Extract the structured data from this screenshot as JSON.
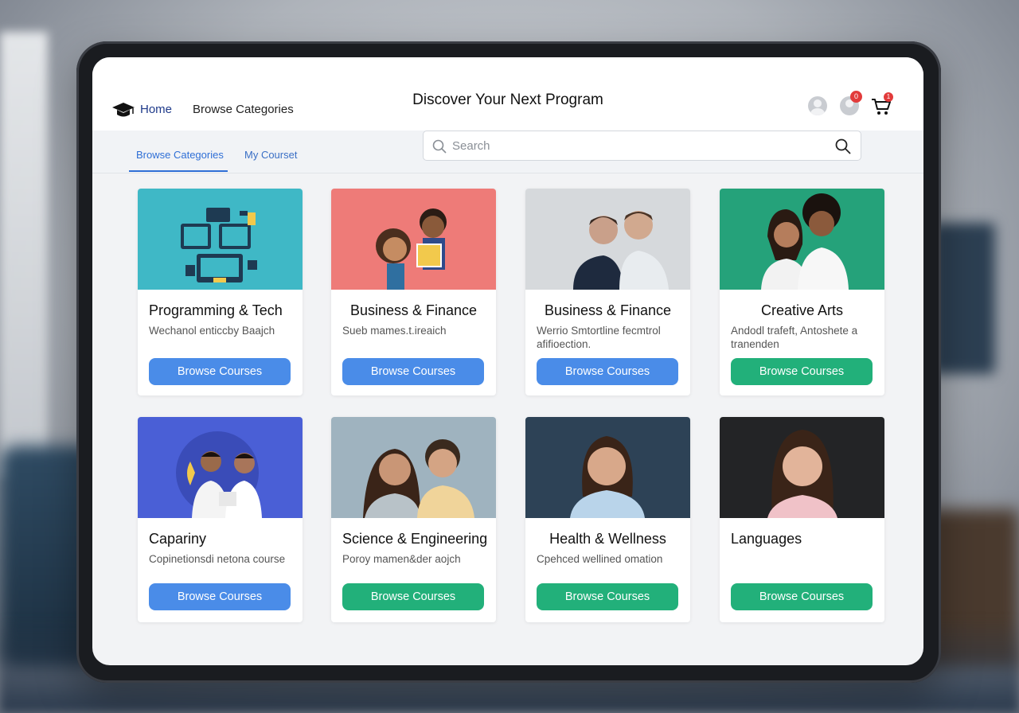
{
  "header": {
    "nav_home": "Home",
    "nav_browse": "Browse Categories",
    "title": "Discover Your Next Program",
    "notification_count": "0",
    "cart_count": "1"
  },
  "subnav": {
    "tabs": [
      {
        "label": "Browse Categories",
        "active": true
      },
      {
        "label": "My Courset",
        "active": false
      }
    ]
  },
  "search": {
    "placeholder": "Search",
    "value": ""
  },
  "cards": [
    {
      "title": "Programming & Tech",
      "description": "Wechanol enticcby Baajch",
      "button": "Browse Courses",
      "button_color": "#4a8ce8",
      "image": "devices-illustration"
    },
    {
      "title": "Business & Finance",
      "description": "Sueb mames.t.ireaich",
      "button": "Browse Courses",
      "button_color": "#4a8ce8",
      "image": "cartoon-characters"
    },
    {
      "title": "Business & Finance",
      "description": "Werrio Smtortline fecmtrol afifioection.",
      "button": "Browse Courses",
      "button_color": "#4a8ce8",
      "image": "two-men-photo"
    },
    {
      "title": "Creative Arts",
      "description": "Andodl trafeft, Antoshete a tranenden",
      "button": "Browse Courses",
      "button_color": "#22b07a",
      "image": "couple-photo"
    },
    {
      "title": "Capariny",
      "description": "Copinetionsdi netona course",
      "button": "Browse Courses",
      "button_color": "#4a8ce8",
      "image": "two-men-blue-photo"
    },
    {
      "title": "Science & Engineering",
      "description": "Poroy mamen&der aojch",
      "button": "Browse Courses",
      "button_color": "#22b07a",
      "image": "couple-smiling-photo"
    },
    {
      "title": "Health & Wellness",
      "description": "Cpehced wellined omation",
      "button": "Browse Courses",
      "button_color": "#22b07a",
      "image": "woman-portrait-photo"
    },
    {
      "title": "Languages",
      "description": "",
      "button": "Browse Courses",
      "button_color": "#22b07a",
      "image": "woman-dark-portrait-photo"
    }
  ],
  "colors": {
    "accent_blue": "#2f6fd6",
    "button_blue": "#4a8ce8",
    "button_green": "#22b07a",
    "badge_red": "#e23b3b"
  }
}
